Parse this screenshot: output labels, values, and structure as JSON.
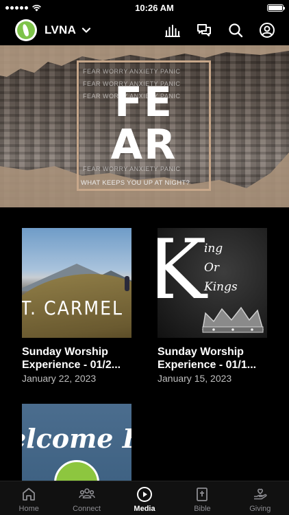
{
  "status_bar": {
    "time": "10:26 AM"
  },
  "header": {
    "org_name": "LVNA"
  },
  "hero": {
    "big_line1": "FE",
    "big_line2": "AR",
    "words": "FEAR WORRY ANXIETY PANIC",
    "tagline": "WHAT KEEPS YOU UP AT NIGHT?"
  },
  "media": [
    {
      "title": "Sunday Worship Experience - 01/2...",
      "title_line1": "Sunday Worship",
      "title_line2": "Experience - 01/2...",
      "date": "January 22, 2023",
      "thumb_text": "T. CARMEL"
    },
    {
      "title": "Sunday Worship Experience - 01/1...",
      "title_line1": "Sunday Worship",
      "title_line2": "Experience - 01/1...",
      "date": "January 15, 2023",
      "thumb_letter": "K",
      "thumb_lines": [
        "ing",
        "Or",
        "Kings"
      ]
    },
    {
      "thumb_text": "elcome Ho"
    }
  ],
  "tabs": [
    {
      "label": "Home",
      "icon": "home-icon",
      "active": false
    },
    {
      "label": "Connect",
      "icon": "group-icon",
      "active": false
    },
    {
      "label": "Media",
      "icon": "play-circle-icon",
      "active": true
    },
    {
      "label": "Bible",
      "icon": "bible-icon",
      "active": false
    },
    {
      "label": "Giving",
      "icon": "giving-hand-icon",
      "active": false
    }
  ],
  "colors": {
    "accent": "#7ec34a",
    "background": "#000000",
    "inactive_tab": "#8e8e93"
  }
}
